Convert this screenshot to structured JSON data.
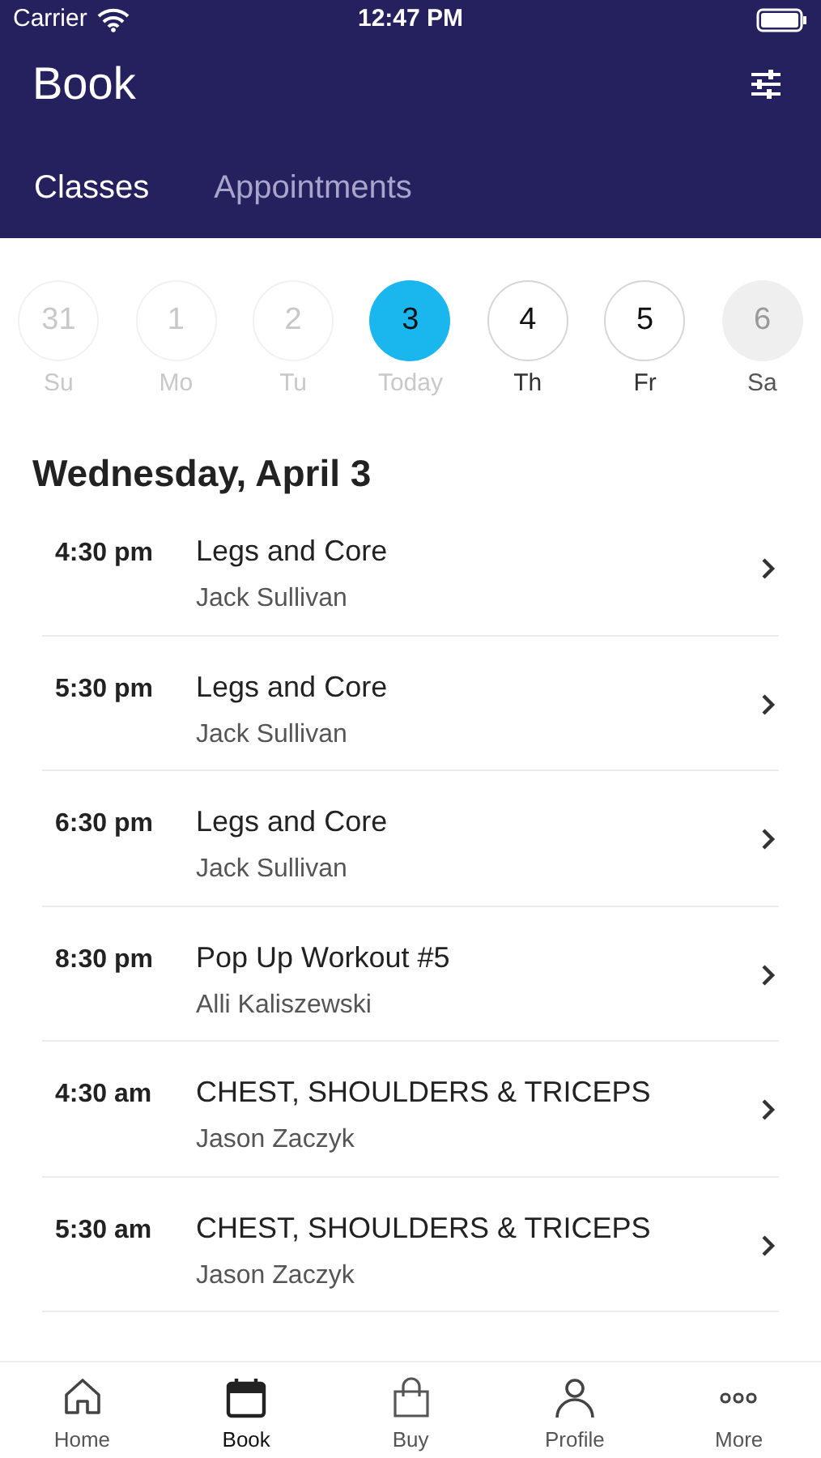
{
  "status_bar": {
    "carrier": "Carrier",
    "time": "12:47 PM"
  },
  "header": {
    "title": "Book"
  },
  "tabs": [
    {
      "label": "Classes",
      "selected": true
    },
    {
      "label": "Appointments",
      "selected": false
    }
  ],
  "days": [
    {
      "number": "31",
      "label": "Su",
      "kind": "past",
      "selected": false
    },
    {
      "number": "1",
      "label": "Mo",
      "kind": "past",
      "selected": false
    },
    {
      "number": "2",
      "label": "Tu",
      "kind": "past",
      "selected": false
    },
    {
      "number": "3",
      "label": "Today",
      "kind": "past",
      "selected": true
    },
    {
      "number": "4",
      "label": "Th",
      "kind": "open",
      "selected": false
    },
    {
      "number": "5",
      "label": "Fr",
      "kind": "open",
      "selected": false
    },
    {
      "number": "6",
      "label": "Sa",
      "kind": "closed",
      "selected": false
    }
  ],
  "date_heading": "Wednesday, April 3",
  "classes": [
    {
      "time": "4:30 pm",
      "name": "Legs and Core",
      "instructor": "Jack Sullivan"
    },
    {
      "time": "5:30 pm",
      "name": "Legs and Core",
      "instructor": "Jack Sullivan"
    },
    {
      "time": "6:30 pm",
      "name": "Legs and Core",
      "instructor": "Jack Sullivan"
    },
    {
      "time": "8:30 pm",
      "name": "Pop Up Workout #5",
      "instructor": "Alli Kaliszewski"
    },
    {
      "time": "4:30 am",
      "name": "CHEST, SHOULDERS & TRICEPS",
      "instructor": "Jason Zaczyk"
    },
    {
      "time": "5:30 am",
      "name": "CHEST, SHOULDERS & TRICEPS",
      "instructor": "Jason Zaczyk"
    }
  ],
  "tab_bar": [
    {
      "label": "Home",
      "kind": "home",
      "selected": false
    },
    {
      "label": "Book",
      "kind": "book",
      "selected": true
    },
    {
      "label": "Buy",
      "kind": "buy",
      "selected": false
    },
    {
      "label": "Profile",
      "kind": "profile",
      "selected": false
    },
    {
      "label": "More",
      "kind": "more",
      "selected": false
    }
  ]
}
